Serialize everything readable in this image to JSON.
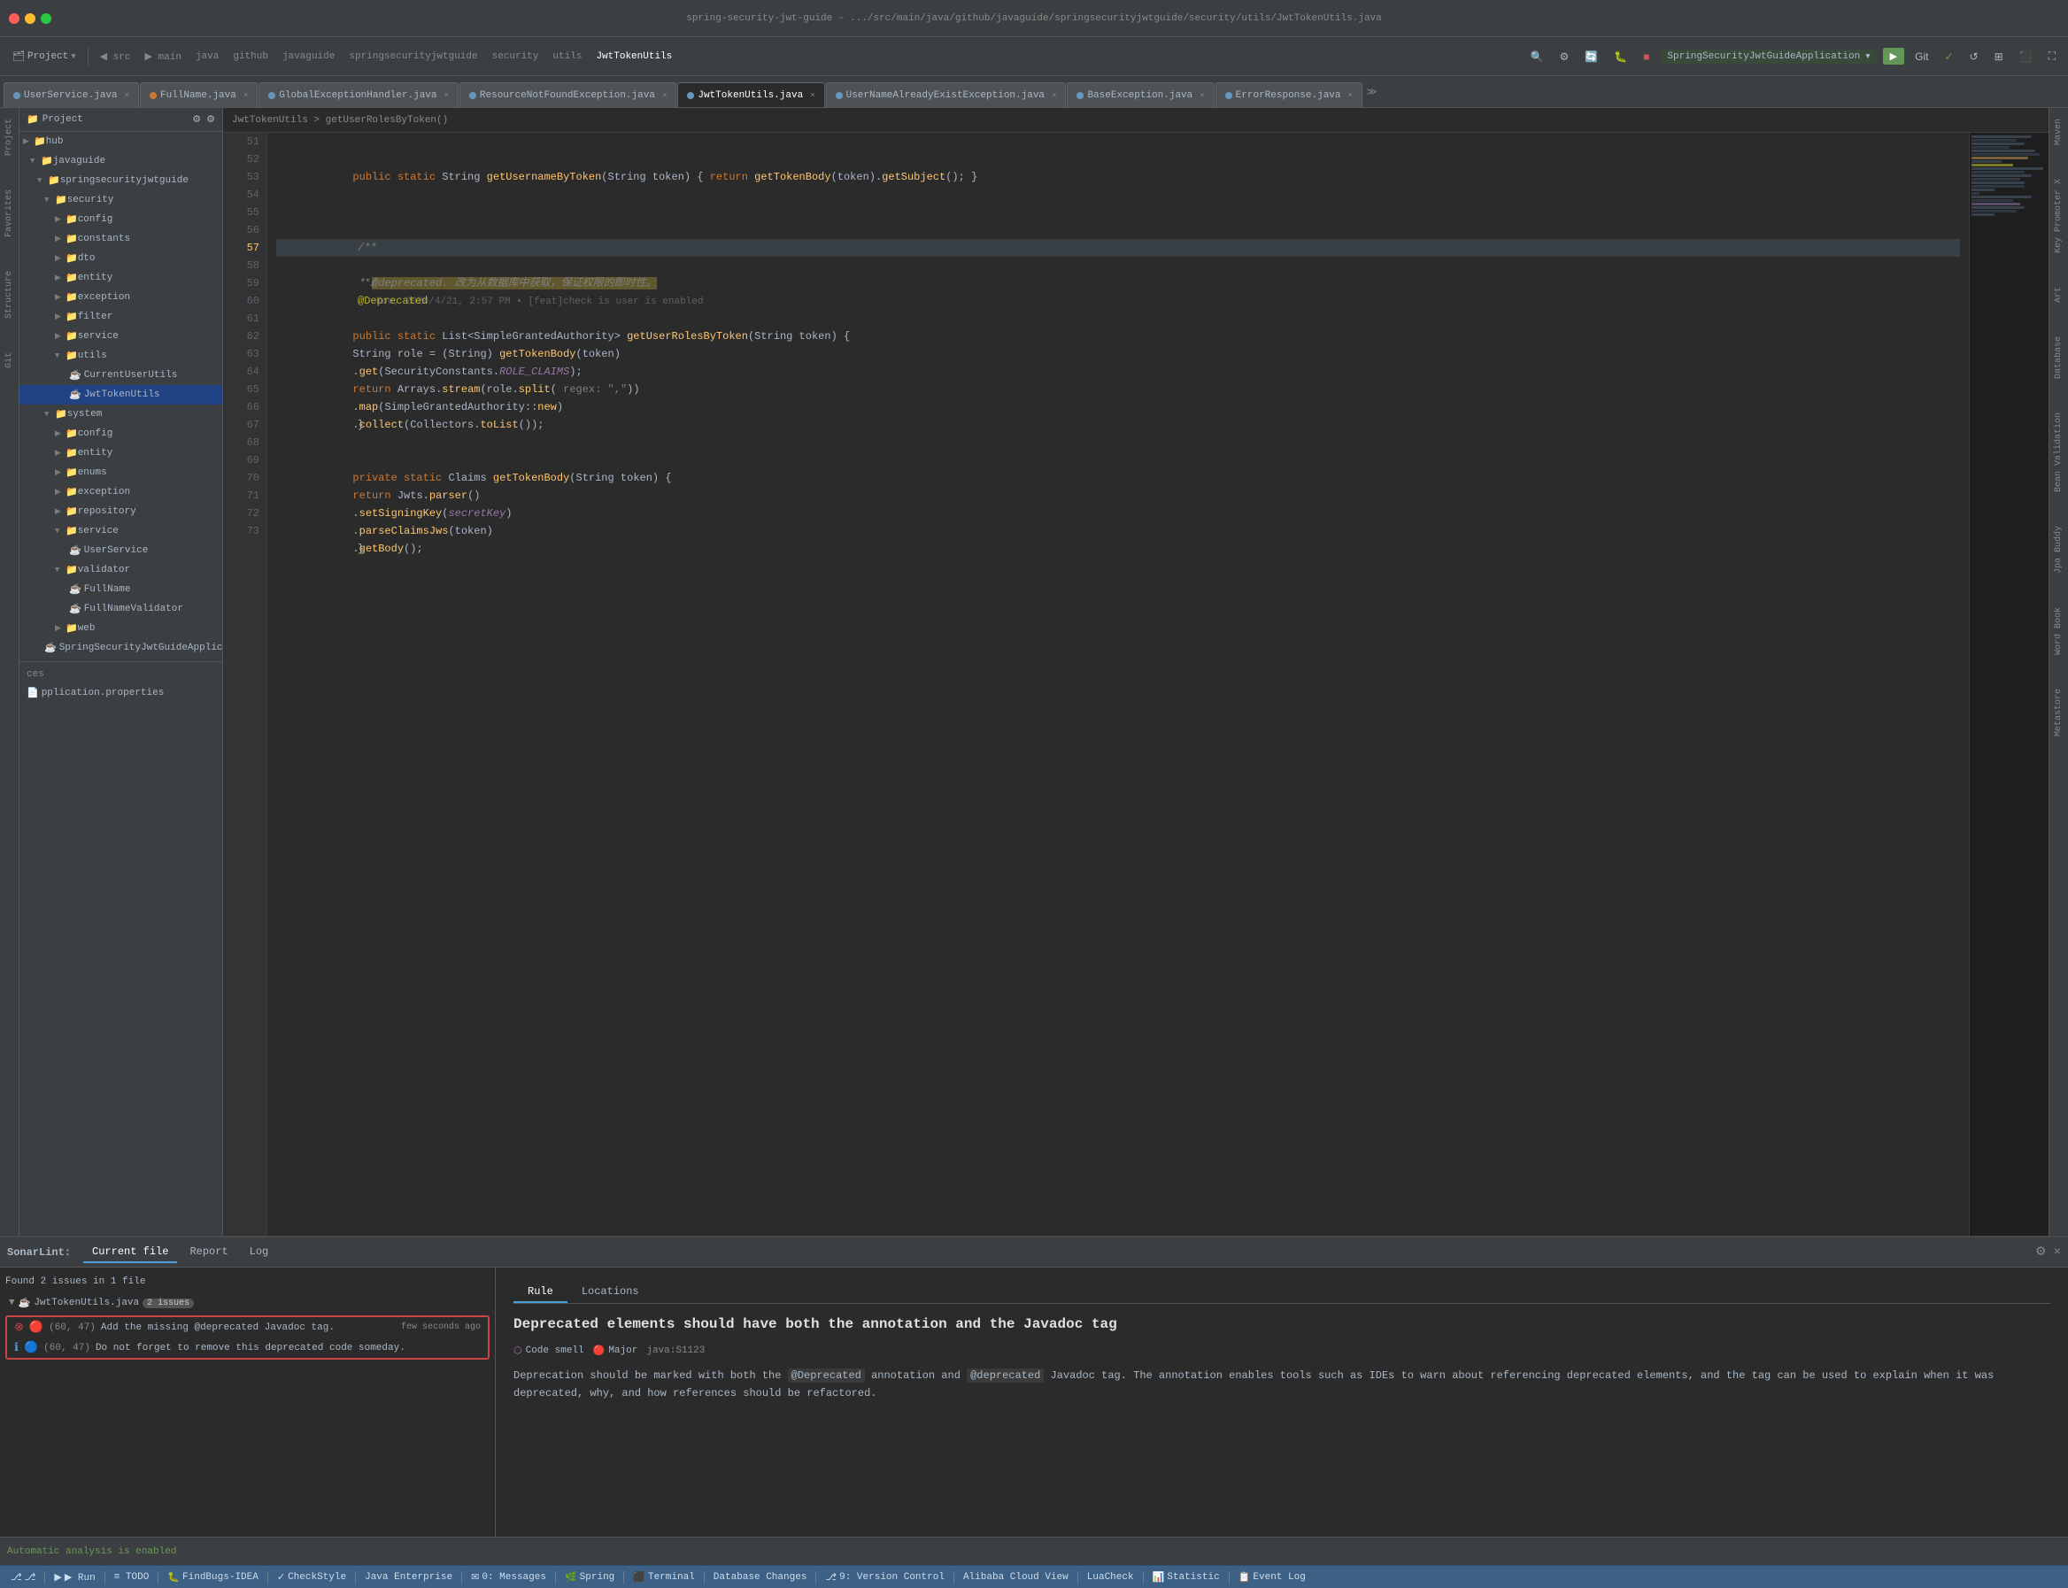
{
  "titlebar": {
    "title": "spring-security-jwt-guide – .../src/main/java/github/javaguide/springsecurityjwtguide/security/utils/JwtTokenUtils.java",
    "project": "spring-security-jwt-guide"
  },
  "toolbar": {
    "project_label": "Project",
    "run_config": "SpringSecurityJwtGuideApplication",
    "breadcrumb": "JwtTokenUtils > getUserRolesByToken()"
  },
  "file_tabs": [
    {
      "name": "UserService.java",
      "type": "java",
      "active": false
    },
    {
      "name": "FullName.java",
      "type": "java",
      "active": false
    },
    {
      "name": "GlobalExceptionHandler.java",
      "type": "java",
      "active": false
    },
    {
      "name": "ResourceNotFoundException.java",
      "type": "java",
      "active": false
    },
    {
      "name": "JwtTokenUtils.java",
      "type": "java",
      "active": true
    },
    {
      "name": "UserNameAlreadyExistException.java",
      "type": "java",
      "active": false
    },
    {
      "name": "BaseException.java",
      "type": "java",
      "active": false
    },
    {
      "name": "ErrorResponse.java",
      "type": "java",
      "active": false
    }
  ],
  "sidebar": {
    "header": "Project",
    "tree": [
      {
        "label": "hub",
        "depth": 0,
        "type": "folder",
        "expanded": false
      },
      {
        "label": "javaguide",
        "depth": 1,
        "type": "folder",
        "expanded": true
      },
      {
        "label": "springsecurityjwtguide",
        "depth": 2,
        "type": "folder",
        "expanded": true
      },
      {
        "label": "security",
        "depth": 3,
        "type": "folder",
        "expanded": true
      },
      {
        "label": "config",
        "depth": 4,
        "type": "folder",
        "expanded": false
      },
      {
        "label": "constants",
        "depth": 4,
        "type": "folder",
        "expanded": false
      },
      {
        "label": "dto",
        "depth": 4,
        "type": "folder",
        "expanded": false
      },
      {
        "label": "entity",
        "depth": 4,
        "type": "folder",
        "expanded": false
      },
      {
        "label": "exception",
        "depth": 4,
        "type": "folder",
        "expanded": false
      },
      {
        "label": "filter",
        "depth": 4,
        "type": "folder",
        "expanded": false
      },
      {
        "label": "service",
        "depth": 4,
        "type": "folder",
        "expanded": false
      },
      {
        "label": "utils",
        "depth": 4,
        "type": "folder",
        "expanded": true
      },
      {
        "label": "CurrentUserUtils",
        "depth": 5,
        "type": "java",
        "expanded": false
      },
      {
        "label": "JwtTokenUtils",
        "depth": 5,
        "type": "java",
        "active": true
      },
      {
        "label": "system",
        "depth": 3,
        "type": "folder",
        "expanded": true
      },
      {
        "label": "config",
        "depth": 4,
        "type": "folder",
        "expanded": false
      },
      {
        "label": "entity",
        "depth": 4,
        "type": "folder",
        "expanded": false
      },
      {
        "label": "enums",
        "depth": 4,
        "type": "folder",
        "expanded": false
      },
      {
        "label": "exception",
        "depth": 4,
        "type": "folder",
        "expanded": false
      },
      {
        "label": "repository",
        "depth": 4,
        "type": "folder",
        "expanded": false
      },
      {
        "label": "service",
        "depth": 4,
        "type": "folder",
        "expanded": true
      },
      {
        "label": "UserService",
        "depth": 5,
        "type": "java"
      },
      {
        "label": "validator",
        "depth": 4,
        "type": "folder",
        "expanded": true
      },
      {
        "label": "FullName",
        "depth": 5,
        "type": "java"
      },
      {
        "label": "FullNameValidator",
        "depth": 5,
        "type": "java"
      },
      {
        "label": "web",
        "depth": 4,
        "type": "folder",
        "expanded": false
      },
      {
        "label": "SpringSecurityJwtGuideApplication",
        "depth": 3,
        "type": "java"
      }
    ],
    "bottom_items": [
      "ces",
      "pplication.properties"
    ]
  },
  "code": {
    "lines": [
      {
        "num": 51,
        "content": "    public static String getUsernameByToken(String token) { return getTokenBody(token).getSubject(); }"
      },
      {
        "num": 52,
        "content": ""
      },
      {
        "num": 53,
        "content": ""
      },
      {
        "num": 54,
        "content": ""
      },
      {
        "num": 55,
        "content": ""
      },
      {
        "num": 56,
        "content": "    /**"
      },
      {
        "num": 57,
        "content": "     * @deprecated. 改为从数据库中获取，保证权限的即时性。    Kou, 2020/4/21, 2:57 PM • [feat]check is user is enabled"
      },
      {
        "num": 58,
        "content": "     */"
      },
      {
        "num": 59,
        "content": "    @Deprecated"
      },
      {
        "num": 60,
        "content": "    public static List<SimpleGrantedAuthority> getUserRolesByToken(String token) {"
      },
      {
        "num": 61,
        "content": "        String role = (String) getTokenBody(token)"
      },
      {
        "num": 62,
        "content": "                .get(SecurityConstants.ROLE_CLAIMS);"
      },
      {
        "num": 63,
        "content": "        return Arrays.stream(role.split( regex: \",\"))"
      },
      {
        "num": 64,
        "content": "                .map(SimpleGrantedAuthority::new)"
      },
      {
        "num": 65,
        "content": "                .collect(Collectors.toList());"
      },
      {
        "num": 66,
        "content": "    }"
      },
      {
        "num": 67,
        "content": ""
      },
      {
        "num": 68,
        "content": "    private static Claims getTokenBody(String token) {"
      },
      {
        "num": 69,
        "content": "        return Jwts.parser()"
      },
      {
        "num": 70,
        "content": "                .setSigningKey(secretKey)"
      },
      {
        "num": 71,
        "content": "                .parseClaimsJws(token)"
      },
      {
        "num": 72,
        "content": "                .getBody();"
      },
      {
        "num": 73,
        "content": "    }"
      }
    ]
  },
  "sonarlint": {
    "title": "SonarLint:",
    "current_file_tab": "Current file",
    "report_tab": "Report",
    "log_tab": "Log",
    "summary": "Found 2 issues in 1 file",
    "file": "JwtTokenUtils.java",
    "issue_count": "2 issues",
    "issues": [
      {
        "location": "(60, 47)",
        "severity": "error",
        "message": "Add the missing @deprecated Javadoc tag.",
        "time": "few seconds ago"
      },
      {
        "location": "(60, 47)",
        "severity": "info",
        "message": "Do not forget to remove this deprecated code someday."
      }
    ],
    "rule_tab_rule": "Rule",
    "rule_tab_locations": "Locations",
    "rule_title": "Deprecated elements should have both the annotation and the Javadoc tag",
    "rule_type": "Code smell",
    "rule_severity": "Major",
    "rule_id": "java:S1123",
    "rule_description": "Deprecation should be marked with both the @Deprecated annotation and @deprecated Javadoc tag. The annotation enables tools such as IDEs to warn about referencing deprecated elements, and the tag can be used to explain when it was deprecated, why, and how references should be refactored."
  },
  "status_bar": {
    "analysis": "Automatic analysis is enabled",
    "git_icon": "⎇",
    "run_label": "▶ Run",
    "todo_label": "≡ TODO",
    "findbugs": "FindBugs-IDEA",
    "checkstyle": "CheckStyle",
    "java_enterprise": "Java Enterprise",
    "messages": "0: Messages",
    "spring": "Spring",
    "terminal": "Terminal",
    "database_changes": "Database Changes",
    "git_version": "9: Version Control",
    "alibaba_cloud": "Alibaba Cloud View",
    "lua_check": "LuaCheck",
    "statistic": "Statistic",
    "event_log": "Event Log"
  },
  "right_panels": {
    "maven": "Maven",
    "key_promoter": "Key Promoter X",
    "art": "Art",
    "database": "Database",
    "bean_validation": "Bean Validation",
    "jpa_buddy": "Jpa Buddy",
    "word_book": "Word Book",
    "metastore": "Metastore"
  }
}
